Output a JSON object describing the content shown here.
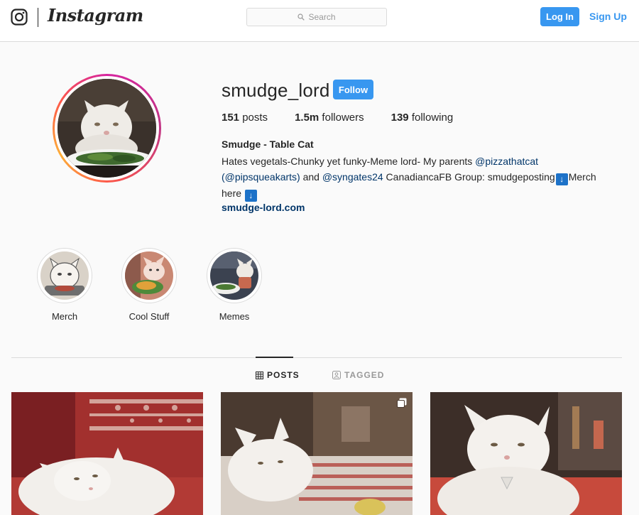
{
  "nav": {
    "brand": "Instagram",
    "logo_icon": "instagram-camera-icon",
    "search_placeholder": "Search",
    "login_label": "Log In",
    "signup_label": "Sign Up"
  },
  "profile": {
    "username": "smudge_lord",
    "follow_label": "Follow",
    "stats": {
      "posts_count": "151",
      "posts_label": " posts",
      "followers_count": "1.5m",
      "followers_label": " followers",
      "following_count": "139",
      "following_label": " following"
    },
    "bio": {
      "name": "Smudge - Table Cat",
      "text_1": "Hates vegetals-Chunky yet funky-Meme lord- My parents ",
      "mention_1": "@pizzathatcat",
      "text_2": " ",
      "mention_2": "(@pipsqueakarts)",
      "text_3": " and ",
      "mention_3": "@syngates24",
      "text_4": " CanadiancaFB Group: smudgeposting",
      "arrow_1": "↓",
      "text_5": "Merch here ",
      "arrow_2": "↓",
      "website": "smudge-lord.com"
    }
  },
  "highlights": [
    {
      "label": "Merch"
    },
    {
      "label": "Cool Stuff"
    },
    {
      "label": "Memes"
    }
  ],
  "tabs": [
    {
      "label": "POSTS",
      "icon": "grid-icon",
      "active": true
    },
    {
      "label": "TAGGED",
      "icon": "tag-person-icon",
      "active": false
    }
  ],
  "colors": {
    "accent": "#3897f0",
    "link": "#003569",
    "text": "#262626",
    "muted": "#999999",
    "border": "#dbdbdb"
  }
}
